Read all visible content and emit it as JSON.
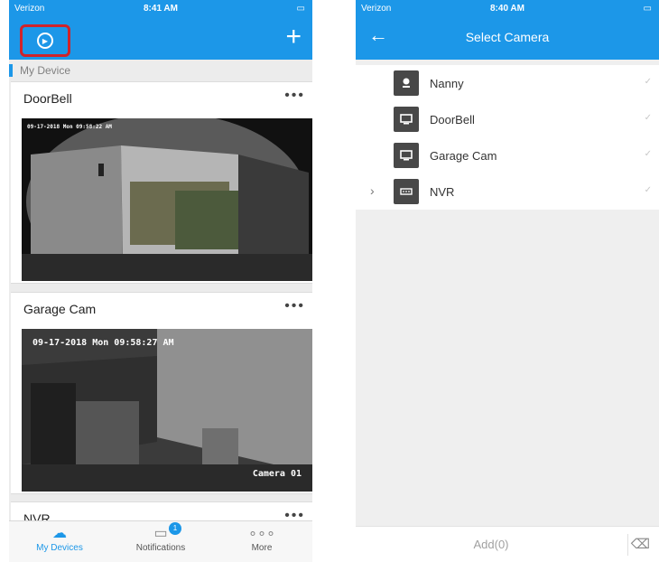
{
  "left": {
    "status": {
      "carrier": "Verizon",
      "time": "8:41 AM"
    },
    "section": "My Device",
    "devices": [
      {
        "name": "DoorBell",
        "more": "•••",
        "stamp": "09-17-2018 Mon 09:58:22 AM"
      },
      {
        "name": "Garage Cam",
        "more": "•••",
        "stamp": "09-17-2018 Mon 09:58:27 AM",
        "caption": "Camera 01"
      },
      {
        "name": "NVR",
        "more": "•••"
      }
    ],
    "tabs": [
      {
        "label": "My Devices",
        "icon": "cloud-icon"
      },
      {
        "label": "Notifications",
        "icon": "notification-icon",
        "badge": "1"
      },
      {
        "label": "More",
        "icon": "more-icon"
      }
    ]
  },
  "right": {
    "status": {
      "carrier": "Verizon",
      "time": "8:40 AM"
    },
    "title": "Select Camera",
    "cameras": [
      {
        "name": "Nanny",
        "icon": "camera-icon"
      },
      {
        "name": "DoorBell",
        "icon": "monitor-icon"
      },
      {
        "name": "Garage Cam",
        "icon": "monitor-icon"
      },
      {
        "name": "NVR",
        "icon": "nvr-icon",
        "expandable": true
      }
    ],
    "add_label": "Add(0)"
  },
  "colors": {
    "accent": "#1c97e8",
    "highlight": "#d0232a"
  }
}
